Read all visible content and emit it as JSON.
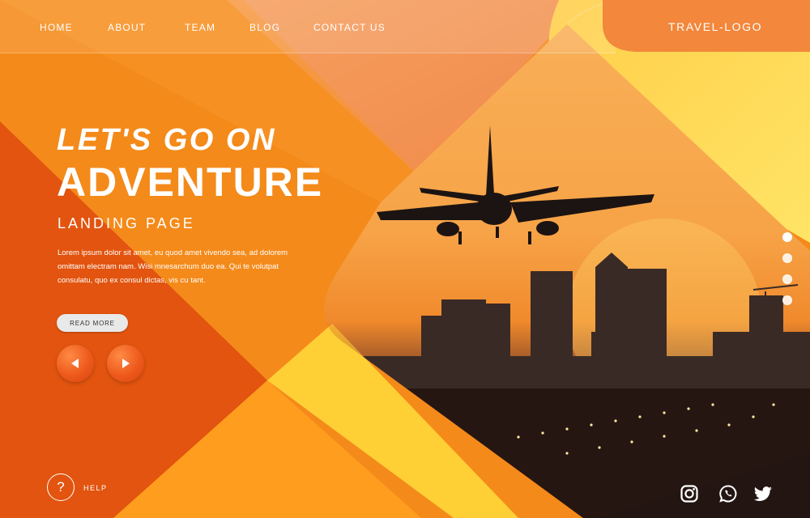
{
  "nav": {
    "items": [
      "HOME",
      "ABOUT",
      "TEAM",
      "BLOG",
      "CONTACT US"
    ],
    "logo": "TRAVEL-LOGO"
  },
  "hero": {
    "line1": "LET'S GO ON",
    "line2": "ADVENTURE",
    "subtitle": "LANDING PAGE",
    "body": "Lorem ipsum dolor sit amet, eu quod amet vivendo sea, ad dolorem omittam electram nam. Wisi mnesarchum duo ea. Qui te volutpat consulatu, quo ex consul dictas, vis cu tant.",
    "read_more": "READ MORE"
  },
  "slider": {
    "prev_icon": "triangle-left-icon",
    "next_icon": "triangle-right-icon",
    "dots": 4
  },
  "help": {
    "icon": "question-mark-icon",
    "label": "HELP",
    "symbol": "?"
  },
  "social": [
    "instagram-icon",
    "whatsapp-icon",
    "twitter-icon"
  ],
  "colors": {
    "orange": "#f48a1a",
    "deep_orange": "#e2540f",
    "yellow": "#ffd23f",
    "peach": "#f7a46a"
  }
}
